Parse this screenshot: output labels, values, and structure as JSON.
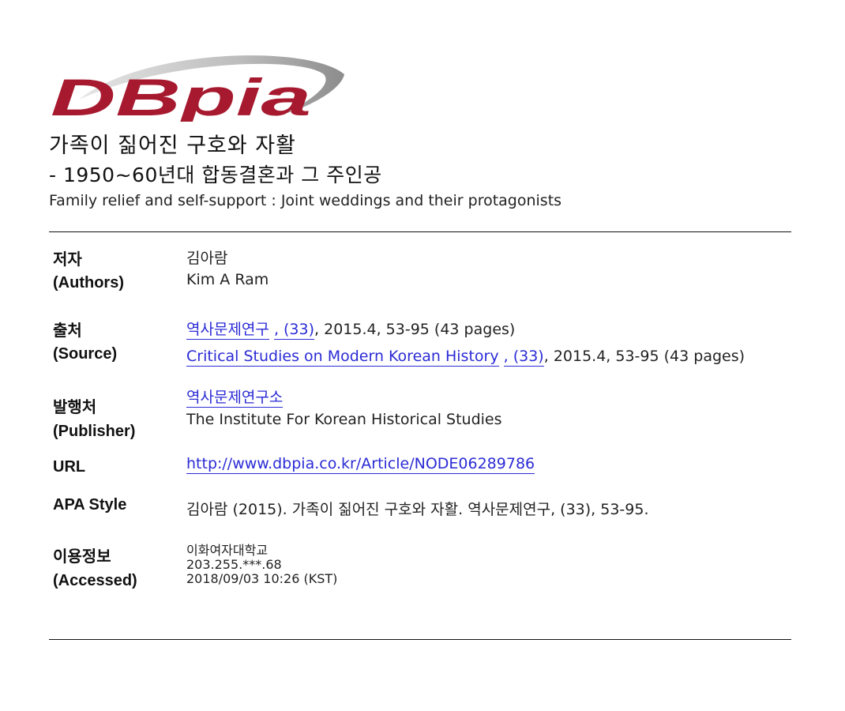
{
  "logo": {
    "text": "DBpia",
    "accent_color": "#a6192e",
    "swoosh_color": "#9a9a9a"
  },
  "title": {
    "korean_line1": "가족이 짊어진 구호와 자활",
    "korean_line2": "- 1950~60년대 합동결혼과 그 주인공",
    "english": "Family relief and self-support : Joint weddings and their protagonists"
  },
  "authors": {
    "label_ko": "저자",
    "label_en": "(Authors)",
    "value_ko": "김아람",
    "value_en": "Kim A Ram"
  },
  "source": {
    "label_ko": "출처",
    "label_en": "(Source)",
    "journal_ko": "역사문제연구",
    "issue_ko": ", (33)",
    "rest_ko": ", 2015.4, 53-95 (43 pages)",
    "journal_en": "Critical Studies on Modern Korean History",
    "issue_en": ", (33)",
    "rest_en": ", 2015.4, 53-95 (43 pages)"
  },
  "publisher": {
    "label_ko": "발행처",
    "label_en": "(Publisher)",
    "value_ko": "역사문제연구소",
    "value_en": "The Institute For Korean Historical Studies"
  },
  "url": {
    "label": "URL",
    "value": "http://www.dbpia.co.kr/Article/NODE06289786"
  },
  "apa": {
    "label": "APA Style",
    "value": "김아람 (2015). 가족이 짊어진 구호와 자활. 역사문제연구, (33), 53-95."
  },
  "accessed": {
    "label_ko": "이용정보",
    "label_en": "(Accessed)",
    "institution": "이화여자대학교",
    "ip": "203.255.***.68",
    "datetime": "2018/09/03 10:26 (KST)"
  },
  "colors": {
    "link": "#2b2bd6",
    "text": "#222222"
  }
}
